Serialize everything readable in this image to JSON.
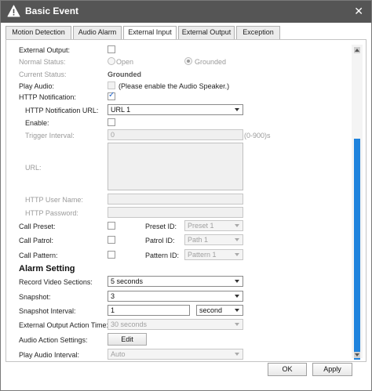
{
  "window": {
    "title": "Basic Event",
    "close_glyph": "✕"
  },
  "tabs": [
    {
      "label": "Motion Detection"
    },
    {
      "label": "Audio Alarm"
    },
    {
      "label": "External Input"
    },
    {
      "label": "External Output"
    },
    {
      "label": "Exception"
    }
  ],
  "active_tab": "External Input",
  "form": {
    "external_output_label": "External Output:",
    "normal_status_label": "Normal Status:",
    "normal_status_options": [
      "Open",
      "Grounded"
    ],
    "normal_status_selected": "Grounded",
    "current_status_label": "Current Status:",
    "current_status_value": "Grounded",
    "play_audio_label": "Play Audio:",
    "play_audio_hint": "(Please enable the Audio Speaker.)",
    "http_notification_label": "HTTP Notification:",
    "http_notification_checked": true,
    "http_url_label": "HTTP Notification URL:",
    "http_url_value": "URL 1",
    "enable_label": "Enable:",
    "trigger_interval_label": "Trigger Interval:",
    "trigger_interval_value": "0",
    "trigger_interval_range": "(0-900)s",
    "url_label": "URL:",
    "http_user_label": "HTTP User Name:",
    "http_password_label": "HTTP Password:",
    "call_preset_label": "Call Preset:",
    "preset_id_label": "Preset ID:",
    "preset_id_value": "Preset 1",
    "call_patrol_label": "Call Patrol:",
    "patrol_id_label": "Patrol ID:",
    "patrol_id_value": "Path 1",
    "call_pattern_label": "Call Pattern:",
    "pattern_id_label": "Pattern ID:",
    "pattern_id_value": "Pattern 1"
  },
  "alarm": {
    "heading": "Alarm Setting",
    "record_label": "Record Video Sections:",
    "record_value": "5 seconds",
    "snapshot_label": "Snapshot:",
    "snapshot_value": "3",
    "snapshot_interval_label": "Snapshot Interval:",
    "snapshot_interval_value": "1",
    "snapshot_interval_unit": "second",
    "ext_output_time_label": "External Output Action Time:",
    "ext_output_time_value": "30 seconds",
    "audio_action_label": "Audio Action Settings:",
    "edit_label": "Edit",
    "play_audio_interval_label": "Play Audio Interval:",
    "play_audio_interval_value": "Auto"
  },
  "footer": {
    "ok_label": "OK",
    "apply_label": "Apply"
  },
  "icons": {
    "warning": "warning-icon",
    "close": "close-icon"
  },
  "colors": {
    "titlebar": "#555555",
    "scrollbar_thumb": "#1f83dd",
    "check": "#2266cc"
  }
}
